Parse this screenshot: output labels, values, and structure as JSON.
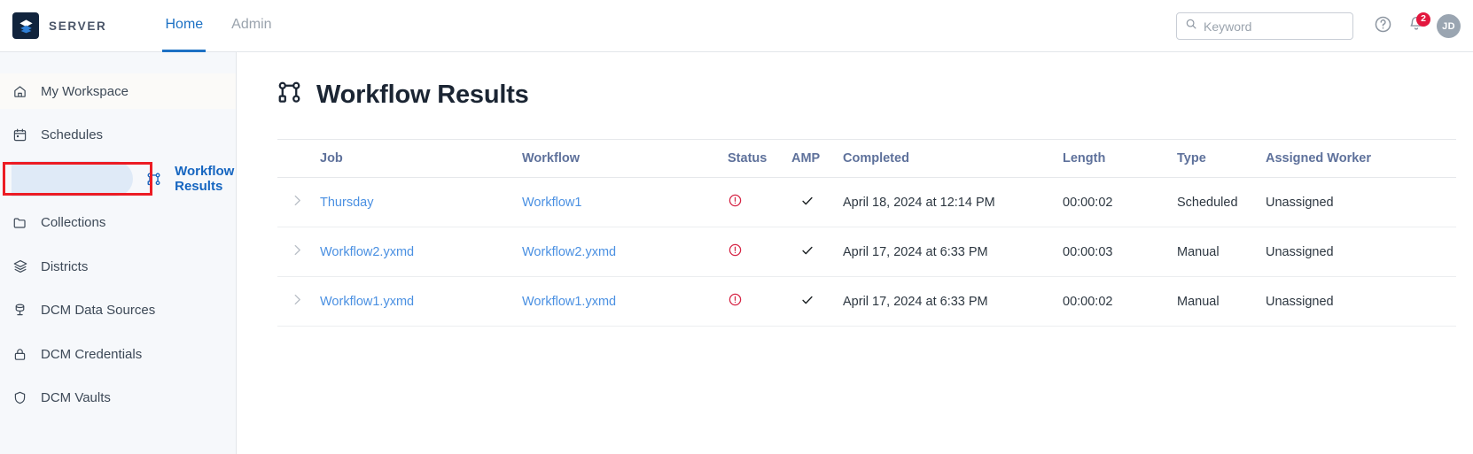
{
  "topbar": {
    "brand_name": "SERVER",
    "logo_icon": "layers-logo-icon",
    "tabs": [
      {
        "label": "Home",
        "active": true
      },
      {
        "label": "Admin",
        "active": false
      }
    ],
    "search": {
      "placeholder": "Keyword",
      "value": "",
      "icon": "search-icon"
    },
    "help_icon": "help-circle-icon",
    "notifications": {
      "icon": "bell-icon",
      "badge_count": "2",
      "badge_color": "#e3173e"
    },
    "avatar_initials": "JD",
    "accent_color": "#1d71c4"
  },
  "sidebar": {
    "items": [
      {
        "label": "My Workspace",
        "icon": "home-icon",
        "state": "hovered"
      },
      {
        "label": "Schedules",
        "icon": "calendar-icon",
        "state": "normal"
      },
      {
        "label": "Workflow Results",
        "icon": "workflow-icon",
        "state": "selected"
      },
      {
        "label": "Collections",
        "icon": "folder-icon",
        "state": "normal"
      },
      {
        "label": "Districts",
        "icon": "layers-icon",
        "state": "normal"
      },
      {
        "label": "DCM Data Sources",
        "icon": "database-icon",
        "state": "normal"
      },
      {
        "label": "DCM Credentials",
        "icon": "lock-icon",
        "state": "normal"
      },
      {
        "label": "DCM Vaults",
        "icon": "shield-icon",
        "state": "normal"
      }
    ],
    "selected_color": "#1565c0",
    "pill_color": "#dfeaf7",
    "annotation_color": "#ec1c24"
  },
  "main": {
    "page_title": "Workflow Results",
    "page_title_icon": "workflow-icon",
    "table": {
      "columns": [
        "",
        "Job",
        "Workflow",
        "Status",
        "AMP",
        "Completed",
        "Length",
        "Type",
        "Assigned Worker"
      ],
      "rows": [
        {
          "expander": "chevron-right-icon",
          "job": "Thursday",
          "workflow": "Workflow1",
          "status_icon": "error-circle-icon",
          "amp_icon": "check-icon",
          "completed": "April 18, 2024 at 12:14 PM",
          "length": "00:00:02",
          "type": "Scheduled",
          "assigned_worker": "Unassigned"
        },
        {
          "expander": "chevron-right-icon",
          "job": "Workflow2.yxmd",
          "workflow": "Workflow2.yxmd",
          "status_icon": "error-circle-icon",
          "amp_icon": "check-icon",
          "completed": "April 17, 2024 at 6:33 PM",
          "length": "00:00:03",
          "type": "Manual",
          "assigned_worker": "Unassigned"
        },
        {
          "expander": "chevron-right-icon",
          "job": "Workflow1.yxmd",
          "workflow": "Workflow1.yxmd",
          "status_icon": "error-circle-icon",
          "amp_icon": "check-icon",
          "completed": "April 17, 2024 at 6:33 PM",
          "length": "00:00:02",
          "type": "Manual",
          "assigned_worker": "Unassigned"
        }
      ],
      "error_color": "#d62545",
      "link_color": "#4a90e2",
      "header_color": "#5e719b"
    }
  }
}
